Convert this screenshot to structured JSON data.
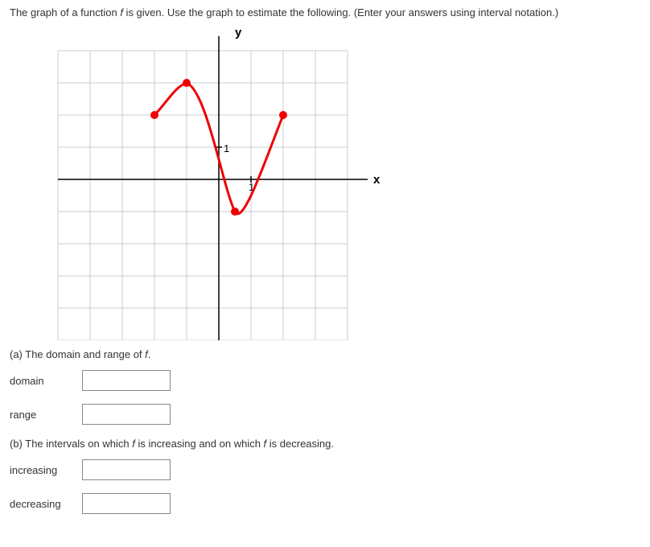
{
  "prompt_before_f": "The graph of a function ",
  "prompt_f": "f",
  "prompt_after_f": " is given. Use the graph to estimate the following. (Enter your answers using interval notation.)",
  "axis_y_label": "y",
  "axis_x_label": "x",
  "tick_label": "1",
  "question_a_prefix": "(a) The domain and range of ",
  "question_a_f": "f",
  "question_a_suffix": ".",
  "label_domain": "domain",
  "label_range": "range",
  "question_b_text_1": "(b) The intervals on which ",
  "question_b_f1": "f",
  "question_b_text_2": " is increasing and on which ",
  "question_b_f2": "f",
  "question_b_text_3": " is decreasing.",
  "label_increasing": "increasing",
  "label_decreasing": "decreasing",
  "chart_data": {
    "type": "line",
    "title": "",
    "xlabel": "x",
    "ylabel": "y",
    "xlim": [
      -5,
      4
    ],
    "ylim": [
      -5,
      4
    ],
    "grid": true,
    "series": [
      {
        "name": "f",
        "points": [
          {
            "x": -2,
            "y": 2
          },
          {
            "x": -1,
            "y": 3
          },
          {
            "x": 0.5,
            "y": -1
          },
          {
            "x": 2,
            "y": 2
          }
        ],
        "endpoints": [
          {
            "x": -2,
            "y": 2,
            "filled": true
          },
          {
            "x": -1,
            "y": 3,
            "filled": true
          },
          {
            "x": 0.5,
            "y": -1,
            "filled": true
          },
          {
            "x": 2,
            "y": 2,
            "filled": true
          }
        ]
      }
    ]
  }
}
